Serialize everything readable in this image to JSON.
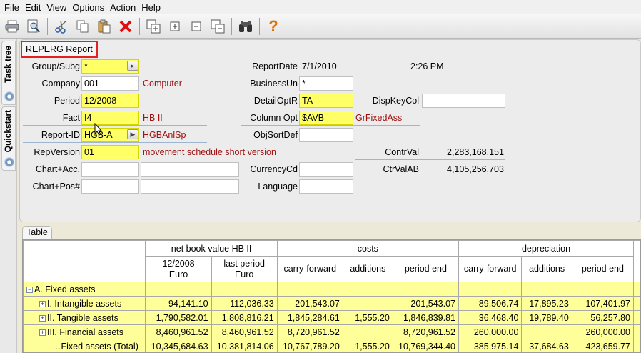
{
  "menu": [
    "File",
    "Edit",
    "View",
    "Options",
    "Action",
    "Help"
  ],
  "side_tabs": [
    "Task tree",
    "Quickstart"
  ],
  "panel": {
    "title": "REPERG Report",
    "left": [
      {
        "label": "Group/Subg",
        "value": "*",
        "desc": ""
      },
      {
        "label": "Company",
        "value": "001",
        "desc": "Computer"
      },
      {
        "label": "Period",
        "value": "12/2008",
        "desc": ""
      },
      {
        "label": "Fact",
        "value": "I4",
        "desc": "HB II"
      },
      {
        "label": "Report-ID",
        "value": "HGB-A",
        "desc": "HGBAnlSp"
      },
      {
        "label": "RepVersion",
        "value": "01",
        "desc": "movement schedule short version"
      },
      {
        "label": "Chart+Acc.",
        "value": "",
        "desc": ""
      },
      {
        "label": "Chart+Pos#",
        "value": "",
        "desc": ""
      }
    ],
    "report_date_label": "ReportDate",
    "report_date": "7/1/2010",
    "report_time": "2:26 PM",
    "middle": [
      {
        "label": "BusinessUn",
        "value": "*",
        "desc": ""
      },
      {
        "label": "DetailOptR",
        "value": "TA",
        "desc": ""
      },
      {
        "label": "Column Opt",
        "value": "$AVB",
        "desc": "GrFixedAss"
      },
      {
        "label": "ObjSortDef",
        "value": "",
        "desc": ""
      },
      {
        "label": "CurrencyCd",
        "value": "",
        "desc": ""
      },
      {
        "label": "Language",
        "value": "",
        "desc": ""
      }
    ],
    "disp_key_col_label": "DispKeyCol",
    "disp_key_col": "",
    "contr_val_label": "ContrVal",
    "contr_val": "2,283,168,151",
    "ctr_val_ab_label": "CtrValAB",
    "ctr_val_ab": "4,105,256,703"
  },
  "table": {
    "tab_label": "Table",
    "groups": [
      "net book value HB II",
      "costs",
      "depreciation"
    ],
    "columns": [
      "12/2008\nEuro",
      "last period\nEuro",
      "carry-forward",
      "additions",
      "period end",
      "carry-forward",
      "additions",
      "period end"
    ],
    "rows": [
      {
        "label": "A. Fixed assets",
        "tree": "−",
        "indent": 0,
        "cells": [
          "",
          "",
          "",
          "",
          "",
          "",
          "",
          ""
        ]
      },
      {
        "label": "I. Intangible assets",
        "tree": "+",
        "indent": 1,
        "cells": [
          "94,141.10",
          "112,036.33",
          "201,543.07",
          "",
          "201,543.07",
          "89,506.74",
          "17,895.23",
          "107,401.97"
        ]
      },
      {
        "label": "II. Tangible assets",
        "tree": "+",
        "indent": 1,
        "cells": [
          "1,790,582.01",
          "1,808,816.21",
          "1,845,284.61",
          "1,555.20",
          "1,846,839.81",
          "36,468.40",
          "19,789.40",
          "56,257.80"
        ]
      },
      {
        "label": "III. Financial assets",
        "tree": "+",
        "indent": 1,
        "cells": [
          "8,460,961.52",
          "8,460,961.52",
          "8,720,961.52",
          "",
          "8,720,961.52",
          "260,000.00",
          "",
          "260,000.00"
        ]
      },
      {
        "label": "Fixed assets (Total)",
        "tree": "",
        "indent": 2,
        "cells": [
          "10,345,684.63",
          "10,381,814.06",
          "10,767,789.20",
          "1,555.20",
          "10,769,344.40",
          "385,975.14",
          "37,684.63",
          "423,659.77"
        ]
      }
    ]
  },
  "colors": {
    "highlight": "#ffff66",
    "row_bg": "#ffff99",
    "desc_text": "#a01010",
    "title_border": "#e52020"
  }
}
